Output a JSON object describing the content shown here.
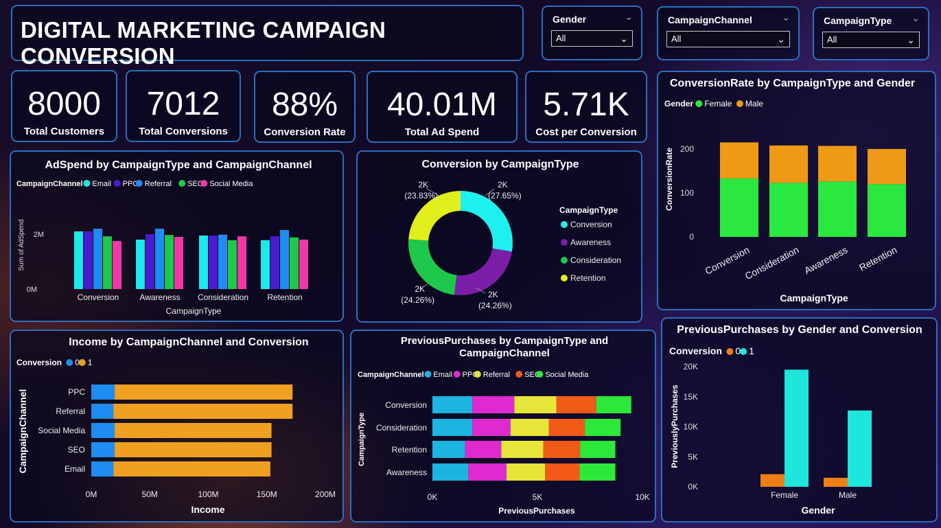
{
  "title": "DIGITAL MARKETING CAMPAIGN CONVERSION",
  "slicers": [
    {
      "label": "Gender",
      "value": "All"
    },
    {
      "label": "CampaignChannel",
      "value": "All"
    },
    {
      "label": "CampaignType",
      "value": "All"
    }
  ],
  "kpis": [
    {
      "value": "8000",
      "label": "Total Customers"
    },
    {
      "value": "7012",
      "label": "Total Conversions"
    },
    {
      "value": "88%",
      "label": "Conversion Rate"
    },
    {
      "value": "40.01M",
      "label": "Total Ad Spend"
    },
    {
      "value": "5.71K",
      "label": "Cost per Conversion"
    }
  ],
  "colors": {
    "email": "#1ce9e9",
    "ppc": "#4b1bd0",
    "referral": "#1e8cf0",
    "seo": "#1ec84b",
    "social": "#ef38a6",
    "conv_0": "#1e8cf0",
    "conv_1": "#f0a020",
    "pp_email": "#1eb4e0",
    "pp_ppc": "#df2ad0",
    "pp_referral": "#e6e63a",
    "pp_seo": "#f25a18",
    "pp_social": "#2ce83a",
    "female": "#2ae840",
    "male": "#ee9a16",
    "donut_conversion": "#1ef0f0",
    "donut_awareness": "#7a1ea8",
    "donut_consideration": "#1ec84b",
    "donut_retention": "#e2ee1c",
    "pg_0": "#f07e16",
    "pg_1": "#1ee6dc"
  },
  "chart_data": [
    {
      "id": "adspend",
      "type": "bar",
      "title": "AdSpend by CampaignType and CampaignChannel",
      "legend_title": "CampaignChannel",
      "xlabel": "CampaignType",
      "ylabel": "Sum of AdSpend",
      "yticks": [
        "0M",
        "2M"
      ],
      "ylim": [
        0,
        3.0
      ],
      "categories": [
        "Conversion",
        "Awareness",
        "Consideration",
        "Retention"
      ],
      "series": [
        {
          "name": "Email",
          "values": [
            2.1,
            1.8,
            1.95,
            1.78
          ]
        },
        {
          "name": "PPC",
          "values": [
            2.1,
            2.0,
            1.95,
            1.92
          ]
        },
        {
          "name": "Referral",
          "values": [
            2.2,
            2.2,
            1.98,
            2.15
          ]
        },
        {
          "name": "SEO",
          "values": [
            1.92,
            1.97,
            1.78,
            1.88
          ]
        },
        {
          "name": "Social Media",
          "values": [
            1.75,
            1.9,
            1.92,
            1.8
          ]
        }
      ]
    },
    {
      "id": "donut",
      "type": "pie",
      "title": "Conversion by CampaignType",
      "legend_title": "CampaignType",
      "slices": [
        {
          "name": "Conversion",
          "value": 27.65,
          "label": "2K",
          "pct": "(27.65%)"
        },
        {
          "name": "Awareness",
          "value": 24.26,
          "label": "2K",
          "pct": "(24.26%)"
        },
        {
          "name": "Consideration",
          "value": 24.26,
          "label": "2K",
          "pct": "(24.26%)"
        },
        {
          "name": "Retention",
          "value": 23.83,
          "label": "2K",
          "pct": "(23.83%)"
        }
      ]
    },
    {
      "id": "convrate",
      "type": "bar",
      "title": "ConversionRate by CampaignType and Gender",
      "legend_title": "Gender",
      "xlabel": "CampaignType",
      "ylabel": "ConversionRate",
      "yticks": [
        "0",
        "100",
        "200"
      ],
      "ylim": [
        0,
        250
      ],
      "categories": [
        "Conversion",
        "Consideration",
        "Awareness",
        "Retention"
      ],
      "series": [
        {
          "name": "Female",
          "values": [
            133,
            123,
            126,
            120
          ]
        },
        {
          "name": "Male",
          "values": [
            82,
            85,
            81,
            80
          ]
        }
      ]
    },
    {
      "id": "income",
      "type": "bar",
      "title": "Income by CampaignChannel and Conversion",
      "legend_title": "Conversion",
      "xlabel": "Income",
      "ylabel": "CampaignChannel",
      "xticks": [
        "0M",
        "50M",
        "100M",
        "150M",
        "200M"
      ],
      "xlim": [
        0,
        200
      ],
      "categories": [
        "PPC",
        "Referral",
        "Social Media",
        "SEO",
        "Email"
      ],
      "series": [
        {
          "name": "0",
          "values": [
            20,
            19,
            20,
            20,
            19
          ]
        },
        {
          "name": "1",
          "values": [
            152,
            153,
            134,
            134,
            134
          ]
        }
      ]
    },
    {
      "id": "prevpurch",
      "type": "bar",
      "title": "PreviousPurchases by CampaignType and CampaignChannel",
      "title_lines": [
        "PreviousPurchases by CampaignType and",
        "CampaignChannel"
      ],
      "legend_title": "CampaignChannel",
      "xlabel": "PreviousPurchases",
      "ylabel": "CampaignType",
      "xticks": [
        "0K",
        "5K",
        "10K"
      ],
      "xlim": [
        0,
        10000
      ],
      "categories": [
        "Conversion",
        "Consideration",
        "Retention",
        "Awareness"
      ],
      "series": [
        {
          "name": "Email",
          "values": [
            1900,
            1900,
            1560,
            1710
          ]
        },
        {
          "name": "PPC",
          "values": [
            2000,
            1820,
            1720,
            1820
          ]
        },
        {
          "name": "Referral",
          "values": [
            2000,
            1820,
            2000,
            1840
          ]
        },
        {
          "name": "SEO",
          "values": [
            1900,
            1720,
            1750,
            1640
          ]
        },
        {
          "name": "Social Media",
          "values": [
            1670,
            1700,
            1680,
            1700
          ]
        }
      ]
    },
    {
      "id": "prevgender",
      "type": "bar",
      "title": "PreviousPurchases by Gender and Conversion",
      "legend_title": "Conversion",
      "xlabel": "Gender",
      "ylabel": "PreviouslyPurchases",
      "yticks": [
        "0K",
        "5K",
        "10K",
        "15K",
        "20K"
      ],
      "ylim": [
        0,
        20000
      ],
      "categories": [
        "Female",
        "Male"
      ],
      "series": [
        {
          "name": "0",
          "values": [
            2100,
            1500
          ]
        },
        {
          "name": "1",
          "values": [
            19500,
            12700
          ]
        }
      ]
    }
  ]
}
